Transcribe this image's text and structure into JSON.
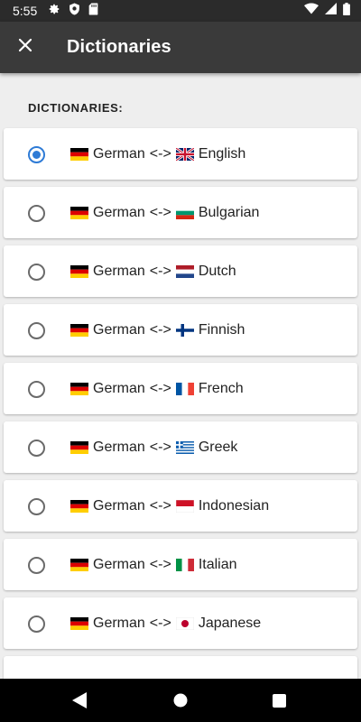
{
  "status_bar": {
    "time": "5:55",
    "left_icons": [
      "gear-icon",
      "shield-icon",
      "sd-card-icon"
    ],
    "right_icons": [
      "wifi-icon",
      "signal-icon",
      "battery-icon"
    ]
  },
  "app_bar": {
    "close_icon": "close-icon",
    "title": "Dictionaries"
  },
  "section_header": "DICTIONARIES:",
  "accent_color": "#2e7bd6",
  "dictionaries": [
    {
      "source": "German",
      "separator": "<->",
      "target": "English",
      "target_flag": "gb",
      "selected": true
    },
    {
      "source": "German",
      "separator": "<->",
      "target": "Bulgarian",
      "target_flag": "bg",
      "selected": false
    },
    {
      "source": "German",
      "separator": "<->",
      "target": "Dutch",
      "target_flag": "nl",
      "selected": false
    },
    {
      "source": "German",
      "separator": "<->",
      "target": "Finnish",
      "target_flag": "fi",
      "selected": false
    },
    {
      "source": "German",
      "separator": "<->",
      "target": "French",
      "target_flag": "fr",
      "selected": false
    },
    {
      "source": "German",
      "separator": "<->",
      "target": "Greek",
      "target_flag": "gr",
      "selected": false
    },
    {
      "source": "German",
      "separator": "<->",
      "target": "Indonesian",
      "target_flag": "id",
      "selected": false
    },
    {
      "source": "German",
      "separator": "<->",
      "target": "Italian",
      "target_flag": "it",
      "selected": false
    },
    {
      "source": "German",
      "separator": "<->",
      "target": "Japanese",
      "target_flag": "jp",
      "selected": false
    }
  ],
  "nav_bar": {
    "icons": [
      "back-icon",
      "home-icon",
      "recents-icon"
    ]
  }
}
